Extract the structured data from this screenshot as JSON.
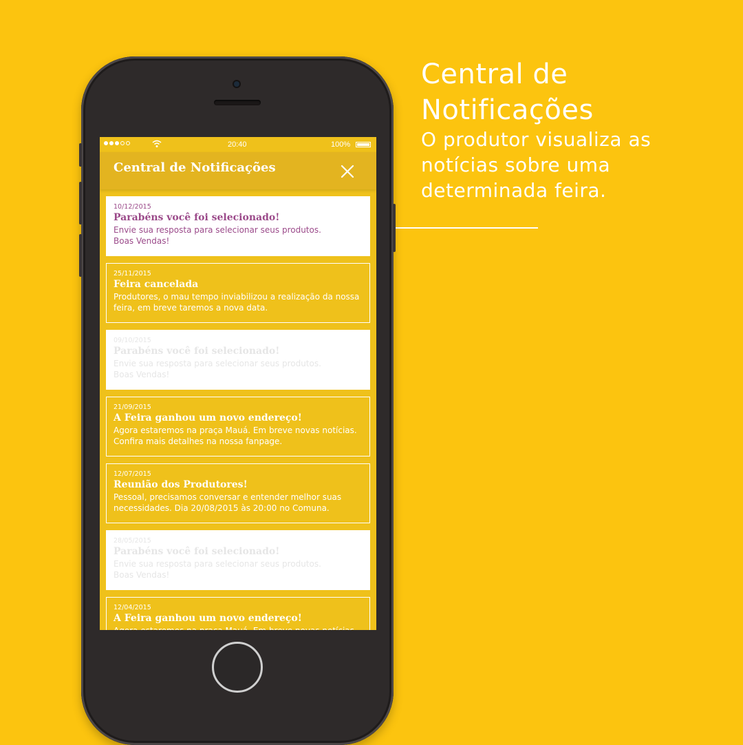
{
  "caption": {
    "title": "Central de Notificações",
    "text": "O produtor visualiza as notícias sobre uma determinada feira."
  },
  "status_bar": {
    "time": "20:40",
    "battery": "100%",
    "signal_icon": "signal-dots-icon",
    "wifi_icon": "wifi-icon"
  },
  "header": {
    "title": "Central de Notificações",
    "close_icon": "close-icon"
  },
  "colors": {
    "background": "#fcc40f",
    "screen": "#efc11b",
    "active_text": "#9b4a8a",
    "faded_text": "#e6e6e6"
  },
  "notifications": [
    {
      "date": "10/12/2015",
      "title": "Parabéns você foi selecionado!",
      "line1": "Envie sua resposta para selecionar seus produtos.",
      "line2": "Boas Vendas!",
      "state": "active"
    },
    {
      "date": "25/11/2015",
      "title": "Feira cancelada",
      "line1": "Produtores, o mau tempo inviabilizou a realização da nossa",
      "line2": "feira, em breve taremos a nova data.",
      "state": "normal"
    },
    {
      "date": "09/10/2015",
      "title": "Parabéns você foi selecionado!",
      "line1": "Envie sua resposta para selecionar seus produtos.",
      "line2": "Boas Vendas!",
      "state": "faded"
    },
    {
      "date": "21/09/2015",
      "title": "A Feira ganhou um novo endereço!",
      "line1": "Agora estaremos na praça Mauá. Em breve novas notícias.",
      "line2": "Confira mais detalhes na nossa fanpage.",
      "state": "normal"
    },
    {
      "date": "12/07/2015",
      "title": "Reunião dos Produtores!",
      "line1": "Pessoal, precisamos conversar e entender melhor suas",
      "line2": "necessidades. Dia 20/08/2015 às 20:00 no Comuna.",
      "state": "normal"
    },
    {
      "date": "28/05/2015",
      "title": "Parabéns você foi selecionado!",
      "line1": "Envie sua resposta para selecionar seus produtos.",
      "line2": "Boas Vendas!",
      "state": "faded"
    },
    {
      "date": "12/04/2015",
      "title": "A Feira ganhou um novo endereço!",
      "line1": "Agora estaremos na praça Mauá. Em breve novas notícias.",
      "line2": "",
      "state": "normal"
    }
  ]
}
